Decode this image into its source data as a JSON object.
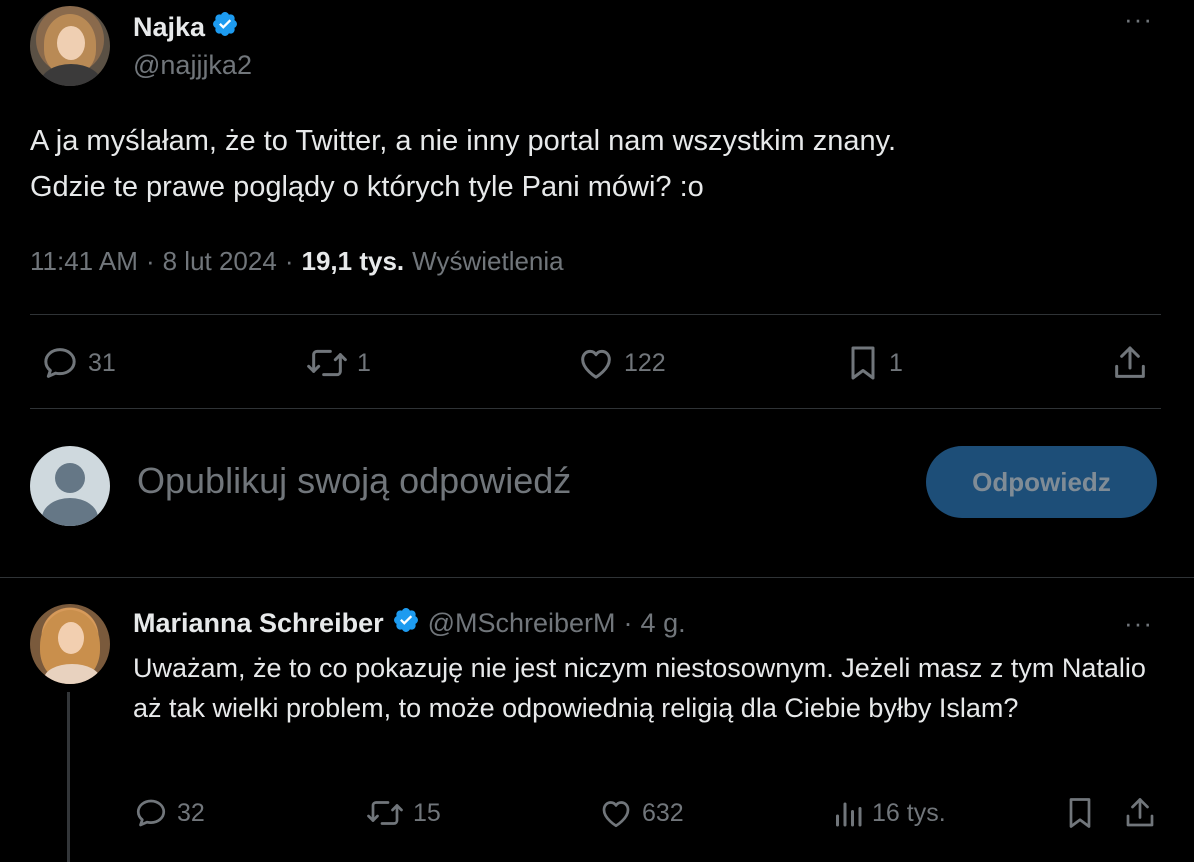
{
  "main_tweet": {
    "author_name": "Najka",
    "author_handle": "@najjjka2",
    "text_line1": "A ja myślałam, że to Twitter, a nie inny portal nam wszystkim znany.",
    "text_line2": "Gdzie te prawe poglądy o których tyle Pani mówi? :o",
    "time": "11:41 AM",
    "date": "8 lut 2024",
    "separator": "·",
    "views_count": "19,1 tys.",
    "views_label": "Wyświetlenia",
    "more_label": "···",
    "actions": {
      "replies": "31",
      "retweets": "1",
      "likes": "122",
      "bookmarks": "1"
    }
  },
  "composer": {
    "placeholder": "Opublikuj swoją odpowiedź",
    "button_label": "Odpowiedz"
  },
  "reply_tweet": {
    "author_name": "Marianna Schreiber",
    "author_handle": "@MSchreiberM",
    "separator": "·",
    "time_ago": "4 g.",
    "more_label": "···",
    "text": "Uważam, że to co pokazuję nie jest niczym niestosownym. Jeżeli masz z tym Natalio aż tak wielki problem, to może odpowiednią  religią dla Ciebie byłby Islam?",
    "actions": {
      "replies": "32",
      "retweets": "15",
      "likes": "632",
      "views": "16 tys."
    }
  },
  "colors": {
    "background": "#000000",
    "text_primary": "#e7e9ea",
    "text_secondary": "#71767b",
    "verified_badge": "#1d9bf0",
    "button_bg_disabled": "#1d4e78",
    "divider": "#2f3336"
  },
  "icons": {
    "verified": "verified-badge-icon",
    "reply": "reply-bubble-icon",
    "retweet": "retweet-icon",
    "like": "heart-icon",
    "bookmark": "bookmark-icon",
    "share": "share-upload-icon",
    "views": "views-bar-chart-icon",
    "more": "more-dots-icon"
  }
}
